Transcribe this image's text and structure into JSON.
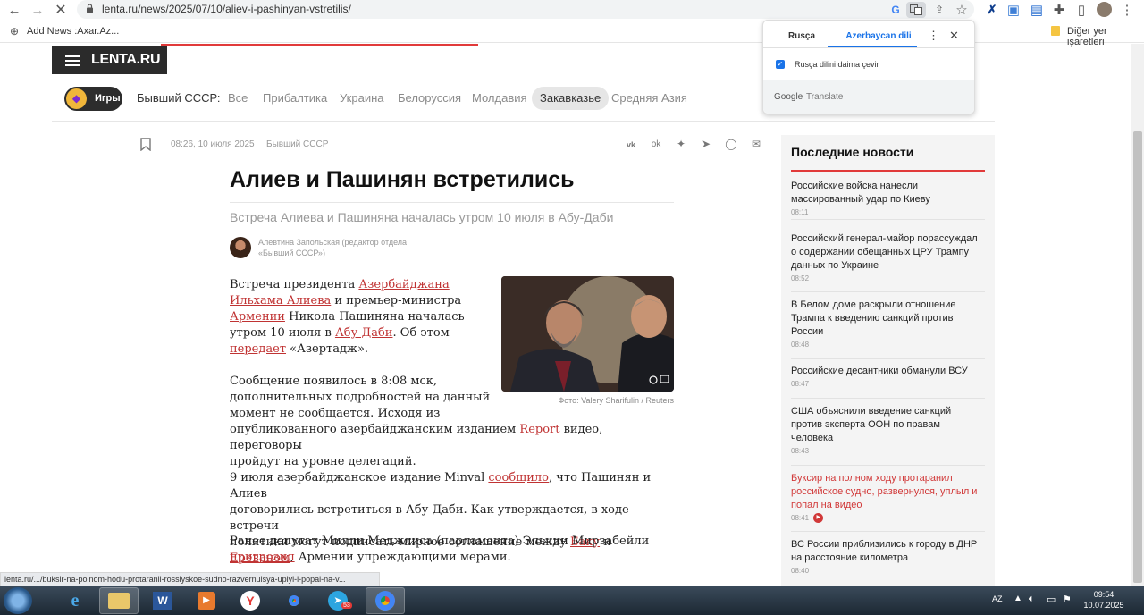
{
  "browser": {
    "url": "lenta.ru/news/2025/07/10/aliev-i-pashinyan-vstretilis/",
    "bookmark_left": "Add News :Axar.Az...",
    "bookmark_right": "Diğer yer işaretleri"
  },
  "translate_popup": {
    "tab_source": "Rusça",
    "tab_target": "Azerbaycan dili",
    "checkbox_label": "Rusça dilini daima çevir",
    "footer_brand": "Google",
    "footer_product": "Translate"
  },
  "site": {
    "logo": "LENTA.RU",
    "games_label": "Игры",
    "nav_label": "Бывший СССР:",
    "nav_items": [
      "Все",
      "Прибалтика",
      "Украина",
      "Белоруссия",
      "Молдавия",
      "Закавказье",
      "Средняя Азия"
    ],
    "nav_active": "Закавказье"
  },
  "article": {
    "datetime": "08:26, 10 июля 2025",
    "rubric": "Бывший СССР",
    "title": "Алиев и Пашинян встретились",
    "subtitle": "Встреча Алиева и Пашиняна началась утром 10 июля в Абу-Даби",
    "author_line1": "Алевтина Запольская (редактор отдела",
    "author_line2": "«Бывший СССР»)",
    "photo_credit": "Фото: Valery Sharifulin / Reuters",
    "p1": {
      "l1a": "Встреча президента ",
      "l1link": "Азербайджана",
      "l2link": "Ильхама Алиева",
      "l2b": " и премьер-министра",
      "l3link": "Армении",
      "l3b": " Никола Пашиняна началась",
      "l4a": "утром 10 июля в ",
      "l4link": "Абу-Даби",
      "l4b": ". Об этом",
      "l5link": "передает",
      "l5b": " «Азертадж»."
    },
    "p2": {
      "l1": "Сообщение появилось в 8:08 мск,",
      "l2": "дополнительных подробностей на данный",
      "l3": "момент не сообщается. Исходя из",
      "l4a": "опубликованного азербайджанским изданием ",
      "l4link": "Report",
      "l4b": " видео, переговоры",
      "l5": "пройдут на уровне делегаций."
    },
    "p3": {
      "l1a": "9 июля азербайджанское издание Minval ",
      "l1link": "сообщило",
      "l1b": ", что Пашинян и Алиев",
      "l2": "договорились встретиться в Абу-Даби. Как утверждается, в ходе встречи",
      "l3a": "политики могут подписать мирное соглашение между ",
      "l3link1": "Баку",
      "l3mid": " и ",
      "l3link2": "Ереваном",
      "l3b": "."
    },
    "p4": {
      "l1": "Ранее депутат Милли Меджлиса (парламента) Эльчин Мирзабейли",
      "l2link": "пригрозил",
      "l2b": " Армении упреждающими мерами."
    }
  },
  "sidebar": {
    "title": "Последние новости",
    "items": [
      {
        "line1": "Российские войска нанесли",
        "line2": "массированный удар по Киеву",
        "line3": "",
        "time": "08:11"
      },
      {
        "line1": "Российский генерал-майор порассуждал",
        "line2": "о содержании обещанных ЦРУ Трампу",
        "line3": "данных по Украине",
        "time": "08:52"
      },
      {
        "line1": "В Белом доме раскрыли отношение",
        "line2": "Трампа к введению санкций против",
        "line3": "России",
        "time": "08:48"
      },
      {
        "line1": "Российские десантники обманули ВСУ",
        "line2": "",
        "line3": "",
        "time": "08:47"
      },
      {
        "line1": "США объяснили введение санкций",
        "line2": "против эксперта ООН по правам",
        "line3": "человека",
        "time": "08:43"
      },
      {
        "line1": "Буксир на полном ходу протаранил",
        "line2": "российское судно, развернулся, уплыл и",
        "line3": "попал на видео",
        "time": "08:41"
      },
      {
        "line1": "ВС России приблизились к городу в ДНР",
        "line2": "на расстояние километра",
        "line3": "",
        "time": "08:40"
      }
    ]
  },
  "status_bar": "lenta.ru/.../buksir-na-polnom-hodu-protaranil-rossiyskoe-sudno-razvernulsya-uplyl-i-popal-na-v...",
  "taskbar": {
    "lang": "AZ",
    "time": "09:54",
    "date": "10.07.2025",
    "telegram_badge": "53"
  }
}
